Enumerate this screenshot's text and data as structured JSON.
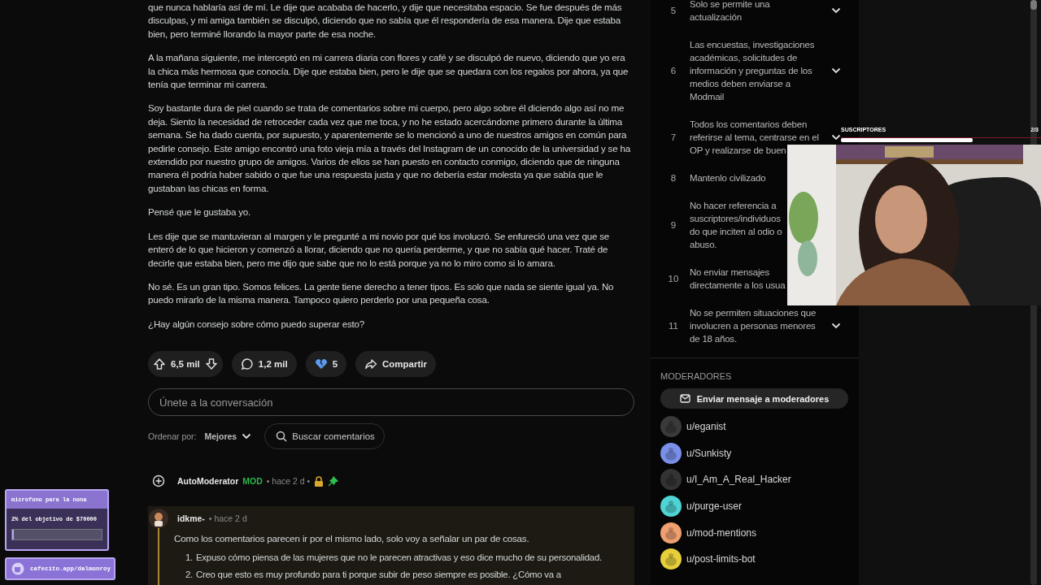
{
  "post": {
    "paragraphs": [
      "que nunca hablaría así de mí. Le dije que acababa de hacerlo, y dije que necesitaba espacio. Se fue después de más disculpas, y mi amiga también se disculpó, diciendo que no sabía que él respondería de esa manera. Dije que estaba bien, pero terminé llorando la mayor parte de esa noche.",
      "A la mañana siguiente, me interceptó en mi carrera diaria con flores y café y se disculpó de nuevo, diciendo que yo era la chica más hermosa que conocía. Dije que estaba bien, pero le dije que se quedara con los regalos por ahora, ya que tenía que terminar mi carrera.",
      "Soy bastante dura de piel cuando se trata de comentarios sobre mi cuerpo, pero algo sobre él diciendo algo así no me deja. Siento la necesidad de retroceder cada vez que me toca, y no he estado acercándome primero durante la última semana. Se ha dado cuenta, por supuesto, y aparentemente se lo mencionó a uno de nuestros amigos en común para pedirle consejo. Este amigo encontró una foto vieja mía a través del Instagram de un conocido de la universidad y se ha extendido por nuestro grupo de amigos. Varios de ellos se han puesto en contacto conmigo, diciendo que de ninguna manera él podría haber sabido o que fue una respuesta justa y que no debería estar molesta ya que sabía que le gustaban las chicas en forma.",
      "Pensé que le gustaba yo.",
      "Les dije que se mantuvieran al margen y le pregunté a mi novio por qué los involucró. Se enfureció una vez que se enteró de lo que hicieron y comenzó a llorar, diciendo que no quería perderme, y que no sabía qué hacer. Traté de decirle que estaba bien, pero me dijo que sabe que no lo está porque ya no lo miro como si lo amara.",
      "No sé. Es un gran tipo. Somos felices. La gente tiene derecho a tener tipos. Es solo que nada se siente igual ya. No puedo mirarlo de la misma manera. Tampoco quiero perderlo por una pequeña cosa.",
      "¿Hay algún consejo sobre cómo puedo superar esto?"
    ],
    "actions": {
      "votes": "6,5 mil",
      "comments": "1,2 mil",
      "awards": "5",
      "share": "Compartir"
    }
  },
  "comment_box": {
    "placeholder": "Únete a la conversación"
  },
  "sort": {
    "label": "Ordenar por:",
    "value": "Mejores",
    "search_placeholder": "Buscar comentarios"
  },
  "comments": [
    {
      "author": "AutoModerator",
      "badge": "MOD",
      "time": "• hace 2 d •",
      "collapsed": true,
      "locked": true,
      "pinned": true,
      "highlighted": false
    },
    {
      "author": "idkme-",
      "time": "• hace 2 d",
      "collapsed": false,
      "locked": false,
      "pinned": false,
      "highlighted": true,
      "text": "Como los comentarios parecen ir por el mismo lado, solo voy a señalar un par de cosas.",
      "list": [
        {
          "marker": "1.",
          "text": "Expuso cómo piensa de las mujeres que no le parecen atractivas y eso dice mucho de su personalidad."
        },
        {
          "marker": "2.",
          "text": "Creo que esto es muy profundo para ti porque subir de peso siempre es posible. ¿Cómo va a"
        }
      ]
    }
  ],
  "sidebar": {
    "rules": [
      {
        "number": "5",
        "text": "Solo se permite una\nactualización",
        "chevron": true
      },
      {
        "number": "6",
        "text": "Las encuestas, investigaciones\nacadémicas, solicitudes de\ninformación y preguntas de los\nmedios deben enviarse a\nModmail",
        "chevron": true
      },
      {
        "number": "7",
        "text": "Todos los comentarios deben\nreferirse al tema, centrarse en el\nOP y realizarse de buen",
        "chevron": true
      },
      {
        "number": "8",
        "text": "Mantenlo civilizado"
      },
      {
        "number": "9",
        "text": "No hacer referencia a\nsuscriptores/individuos\ndo que inciten al odio o\nabuso."
      },
      {
        "number": "10",
        "text": "No enviar mensajes\ndirectamente a los usua"
      },
      {
        "number": "11",
        "text": "No se permiten situaciones que\ninvolucren a personas menores\nde 18 años.",
        "chevron": true
      }
    ],
    "moderators_title": "MODERADORES",
    "message_button": "Enviar mensaje a moderadores",
    "moderators": [
      {
        "name": "u/eganist",
        "color": "#3a3a3a"
      },
      {
        "name": "u/Sunkisty",
        "color": "#7a8fe8"
      },
      {
        "name": "u/I_Am_A_Real_Hacker",
        "color": "#333333"
      },
      {
        "name": "u/purge-user",
        "color": "#4fd3d3"
      },
      {
        "name": "u/mod-mentions",
        "color": "#f0a070"
      },
      {
        "name": "u/post-limits-bot",
        "color": "#e6cf3a"
      }
    ]
  },
  "overlay": {
    "goal_label": "SUSCRIPTORES",
    "goal_count": "2/3",
    "level": 0.66,
    "donation": {
      "title": "microfono para la nona",
      "progress": "2% del objetivo de $70000",
      "level": 0.02
    },
    "link": "cafecito.app/dalmonroy"
  }
}
